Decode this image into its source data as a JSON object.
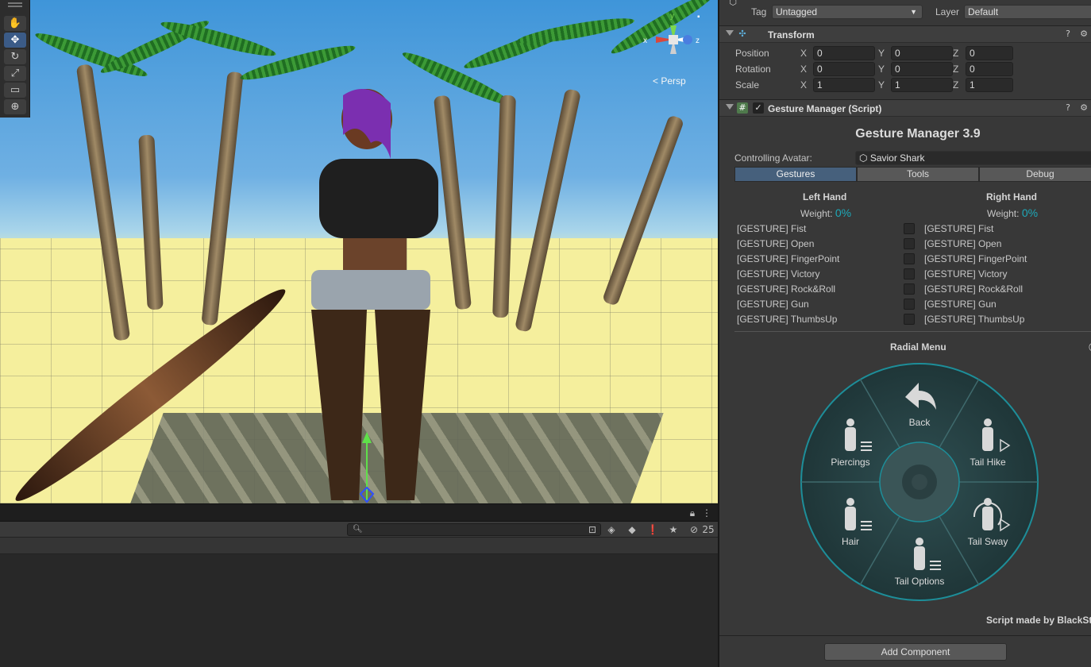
{
  "scene": {
    "tools": [
      "hand-tool",
      "move-tool",
      "rotate-tool",
      "scale-tool",
      "rect-tool",
      "transform-tool"
    ],
    "gizmo": {
      "x_label": "x",
      "y_label": "y",
      "z_label": "z",
      "projection": "< Persp"
    }
  },
  "bottom": {
    "search_placeholder": "",
    "hidden_count": "25"
  },
  "inspector": {
    "tag_label": "Tag",
    "tag_value": "Untagged",
    "layer_label": "Layer",
    "layer_value": "Default",
    "transform": {
      "title": "Transform",
      "rows": [
        {
          "label": "Position",
          "x": "0",
          "y": "0",
          "z": "0"
        },
        {
          "label": "Rotation",
          "x": "0",
          "y": "0",
          "z": "0"
        },
        {
          "label": "Scale",
          "x": "1",
          "y": "1",
          "z": "1"
        }
      ],
      "axes": [
        "X",
        "Y",
        "Z"
      ]
    },
    "gesture_manager": {
      "header": "Gesture Manager (Script)",
      "title": "Gesture Manager 3.9",
      "controlling_label": "Controlling Avatar:",
      "avatar": "Savior Shark",
      "tabs": [
        "Gestures",
        "Tools",
        "Debug"
      ],
      "selected_tab": "Gestures",
      "left": {
        "title": "Left Hand",
        "weight_label": "Weight:",
        "weight": "0%"
      },
      "right": {
        "title": "Right Hand",
        "weight_label": "Weight:",
        "weight": "0%"
      },
      "gestures_left": [
        "[GESTURE] Fist",
        "[GESTURE] Open",
        "[GESTURE] FingerPoint",
        "[GESTURE] Victory",
        "[GESTURE] Rock&Roll",
        "[GESTURE] Gun",
        "[GESTURE] ThumbsUp"
      ],
      "gestures_right": [
        "[GESTURE] Fist",
        "[GESTURE] Open",
        "[GESTURE] FingerPoint",
        "[GESTURE] Victory",
        "[GESTURE] Rock&Roll",
        "[GESTURE] Gun",
        "[GESTURE] ThumbsUp"
      ],
      "radial_title": "Radial Menu",
      "radial_items": [
        "Back",
        "Tail Hike",
        "Tail Sway",
        "Tail Options",
        "Hair",
        "Piercings"
      ],
      "script_by": "Script made by BlackStart",
      "add_component": "Add Component"
    },
    "accent": "#1ea8b8"
  }
}
